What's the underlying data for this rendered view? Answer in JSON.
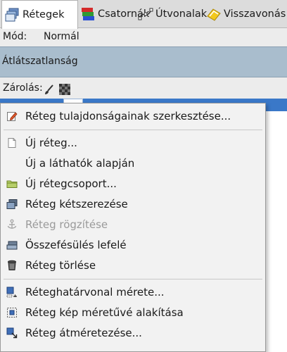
{
  "tabs": [
    {
      "label": "Rétegek",
      "icon": "layers-icon",
      "active": true
    },
    {
      "label": "Csatornák",
      "icon": "channels-icon",
      "active": false
    },
    {
      "label": "Útvonalak",
      "icon": "paths-icon",
      "active": false
    },
    {
      "label": "Visszavonás",
      "icon": "undo-history-icon",
      "active": false
    }
  ],
  "mode": {
    "label": "Mód:",
    "value": "Normál"
  },
  "opacity": {
    "label": "Átlátszatlanság"
  },
  "lock": {
    "label": "Zárolás:",
    "icons": [
      "lock-pixels-icon",
      "lock-alpha-icon"
    ]
  },
  "colors": {
    "selected_layer": "#3a78c8",
    "opacity_bar": "#a9bdcd",
    "menu_background": "#f2f2f2",
    "disabled_text": "#9a9a9a"
  },
  "context_menu": {
    "items": [
      {
        "label": "Réteg tulajdonságainak szerkesztése...",
        "icon": "edit-properties-icon",
        "enabled": true
      },
      {
        "label": "Új réteg...",
        "icon": "new-layer-icon",
        "enabled": true
      },
      {
        "label": "Új a láthatók alapján",
        "icon": "",
        "enabled": true
      },
      {
        "label": "Új rétegcsoport...",
        "icon": "folder-icon",
        "enabled": true
      },
      {
        "label": "Réteg kétszerezése",
        "icon": "duplicate-icon",
        "enabled": true
      },
      {
        "label": "Réteg rögzítése",
        "icon": "anchor-icon",
        "enabled": false
      },
      {
        "label": "Összefésülés lefelé",
        "icon": "merge-down-icon",
        "enabled": true
      },
      {
        "label": "Réteg törlése",
        "icon": "trash-icon",
        "enabled": true
      },
      {
        "label": "Réteghatárvonal mérete...",
        "icon": "boundary-size-icon",
        "enabled": true
      },
      {
        "label": "Réteg kép méretűvé alakítása",
        "icon": "layer-to-image-size-icon",
        "enabled": true
      },
      {
        "label": "Réteg átméretezése...",
        "icon": "scale-layer-icon",
        "enabled": true
      }
    ]
  }
}
